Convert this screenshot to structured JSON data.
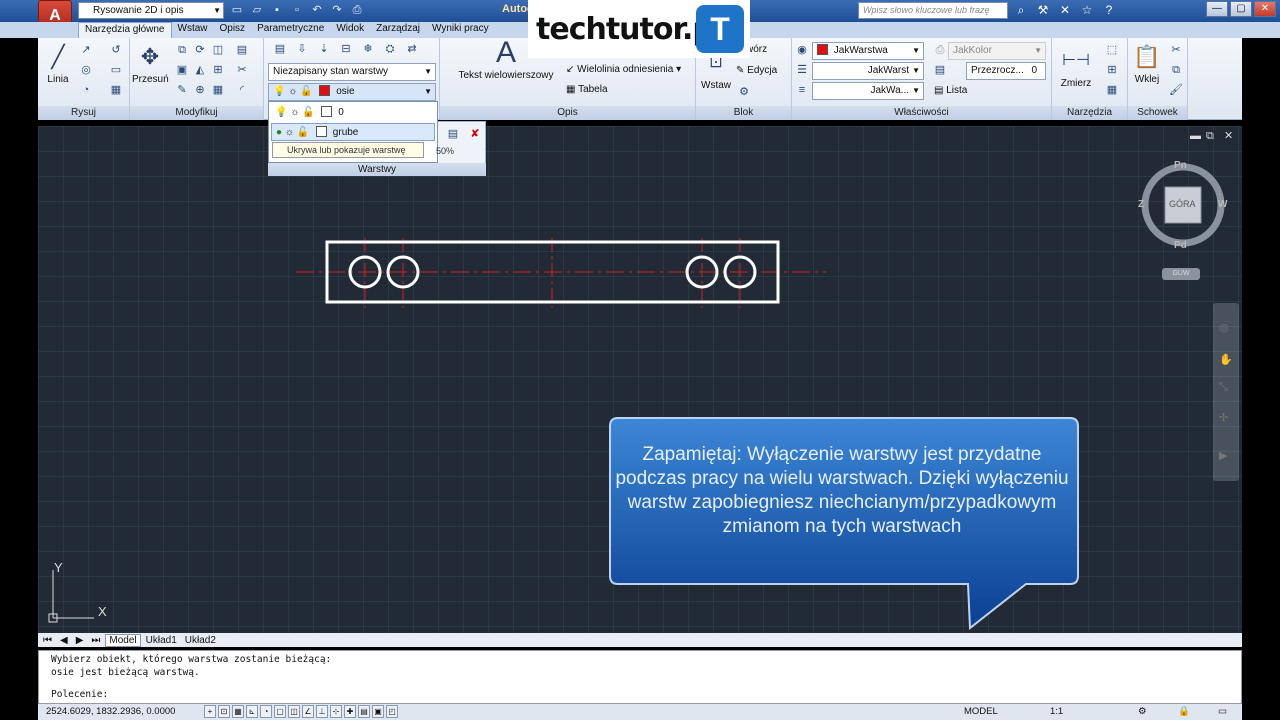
{
  "titlebar": {
    "app_button": "A",
    "workspace": "Rysowanie 2D i opis",
    "title": "Autod",
    "search_placeholder": "Wpisz słowo kluczowe lub frazę"
  },
  "tabs": [
    "Narzędzia główne",
    "Wstaw",
    "Opisz",
    "Parametryczne",
    "Widok",
    "Zarządzaj",
    "Wyniki pracy"
  ],
  "ribbon": {
    "rysuj": {
      "label": "Rysuj",
      "linia": "Linia"
    },
    "modyfikuj": {
      "label": "Modyfikuj",
      "przesun": "Przesuń"
    },
    "warstwy": {
      "label": "Warstwy",
      "state": "Niezapisany stan warstwy",
      "current": "osie"
    },
    "opis": {
      "label": "Opis",
      "tekst": "Tekst wielowierszowy",
      "wielolinia": "Wielolinia odniesienia",
      "tabela": "Tabela"
    },
    "blok": {
      "label": "Blok",
      "wstaw": "Wstaw",
      "utworz": "Utwórz",
      "edycja": "Edycja"
    },
    "wlasciwosci": {
      "label": "Właściwości",
      "kolor_warstwa": "JakWarstwa",
      "jak_kolor": "JakKolor",
      "rodzaj1": "JakWarst",
      "rodzaj2": "JakWa...",
      "przezrocz": "Przezrocz...",
      "przezrocz_val": "0",
      "lista": "Lista"
    },
    "narzedzia": {
      "label": "Narzędzia",
      "zmierz": "Zmierz"
    },
    "schowek": {
      "label": "Schowek",
      "wklej": "Wklej"
    }
  },
  "layer_dropdown": {
    "rows": [
      {
        "name": "0"
      },
      {
        "name": "grube"
      }
    ],
    "tooltip": "Ukrywa lub pokazuje warstwę",
    "percent": "50%"
  },
  "viewcube": {
    "n": "Pn",
    "s": "Pd",
    "w": "Z",
    "e": "W",
    "top": "GÓRA",
    "wcs": "GUW"
  },
  "callout": "Zapamiętaj: Wyłączenie warstwy jest przydatne podczas pracy na wielu warstwach. Dzięki wyłączeniu warstw zapobiegniesz niechcianym/przypadkowym zmianom na tych warstwach",
  "ucs": {
    "y": "Y",
    "x": "X"
  },
  "layout_tabs": [
    "Model",
    "Układ1",
    "Układ2"
  ],
  "command": {
    "line1": "Wybierz obiekt, którego warstwa zostanie bieżącą:",
    "line2": "osie jest bieżącą warstwą.",
    "prompt": "Polecenie:"
  },
  "status": {
    "coords": "2524.6029, 1832.2936, 0.0000",
    "model": "MODEL",
    "scale": "1:1"
  },
  "logo": {
    "text": "techtutor.pl",
    "badge": "T"
  },
  "colors": {
    "layer_osie": "#e01010",
    "accent": "#1d74c9"
  }
}
